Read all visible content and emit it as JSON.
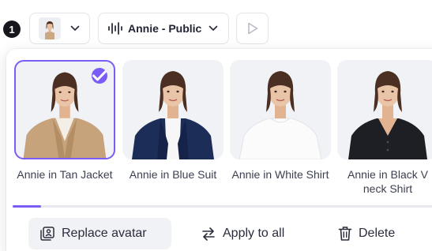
{
  "toolbar": {
    "step_number": "1",
    "avatar_select": {
      "icon": "avatar-thumbnail"
    },
    "voice_select": {
      "label": "Annie - Public",
      "icon": "waveform-icon"
    },
    "play_button": {
      "icon": "play-icon"
    }
  },
  "avatars": [
    {
      "name": "Annie in Tan Jacket",
      "selected": true,
      "outfit": "tan jacket"
    },
    {
      "name": "Annie in Blue Suit",
      "selected": false,
      "outfit": "blue suit"
    },
    {
      "name": "Annie in White Shirt",
      "selected": false,
      "outfit": "white shirt"
    },
    {
      "name": "Annie in Black V neck Shirt",
      "selected": false,
      "outfit": "black v neck"
    }
  ],
  "scroll": {
    "position": 0.07
  },
  "actions": {
    "replace_label": "Replace avatar",
    "apply_label": "Apply to all",
    "delete_label": "Delete"
  },
  "colors": {
    "accent": "#7b5cf6",
    "text": "#1f2333",
    "card_bg": "#f1f2f6"
  }
}
